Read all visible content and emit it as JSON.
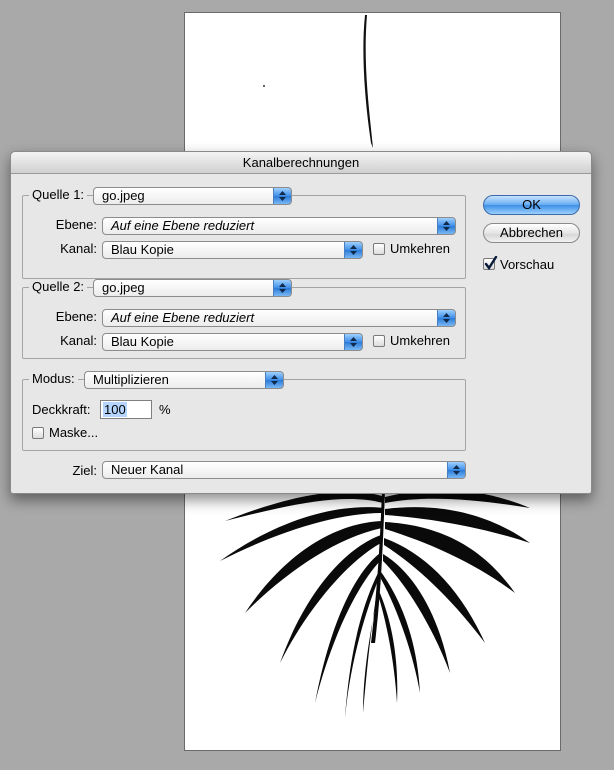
{
  "dialog": {
    "title": "Kanalberechnungen",
    "source1": {
      "label": "Quelle 1:",
      "file": "go.jpeg",
      "layer_label": "Ebene:",
      "layer_value": "Auf eine Ebene reduziert",
      "channel_label": "Kanal:",
      "channel_value": "Blau Kopie",
      "invert_label": "Umkehren",
      "invert_checked": false
    },
    "source2": {
      "label": "Quelle 2:",
      "file": "go.jpeg",
      "layer_label": "Ebene:",
      "layer_value": "Auf eine Ebene reduziert",
      "channel_label": "Kanal:",
      "channel_value": "Blau Kopie",
      "invert_label": "Umkehren",
      "invert_checked": false
    },
    "blending": {
      "mode_label": "Modus:",
      "mode_value": "Multiplizieren",
      "opacity_label": "Deckkraft:",
      "opacity_value": "100",
      "opacity_unit": "%",
      "mask_label": "Maske...",
      "mask_checked": false
    },
    "target": {
      "label": "Ziel:",
      "value": "Neuer Kanal"
    },
    "buttons": {
      "ok": "OK",
      "cancel": "Abbrechen"
    },
    "preview": {
      "label": "Vorschau",
      "checked": true
    }
  },
  "colors": {
    "accent": "#3d8fe6",
    "background": "#a9a9a9",
    "dialog": "#e7e7e7"
  },
  "icons": [
    "popup-arrows-icon",
    "checkmark-icon",
    "palm-leaf-image"
  ]
}
